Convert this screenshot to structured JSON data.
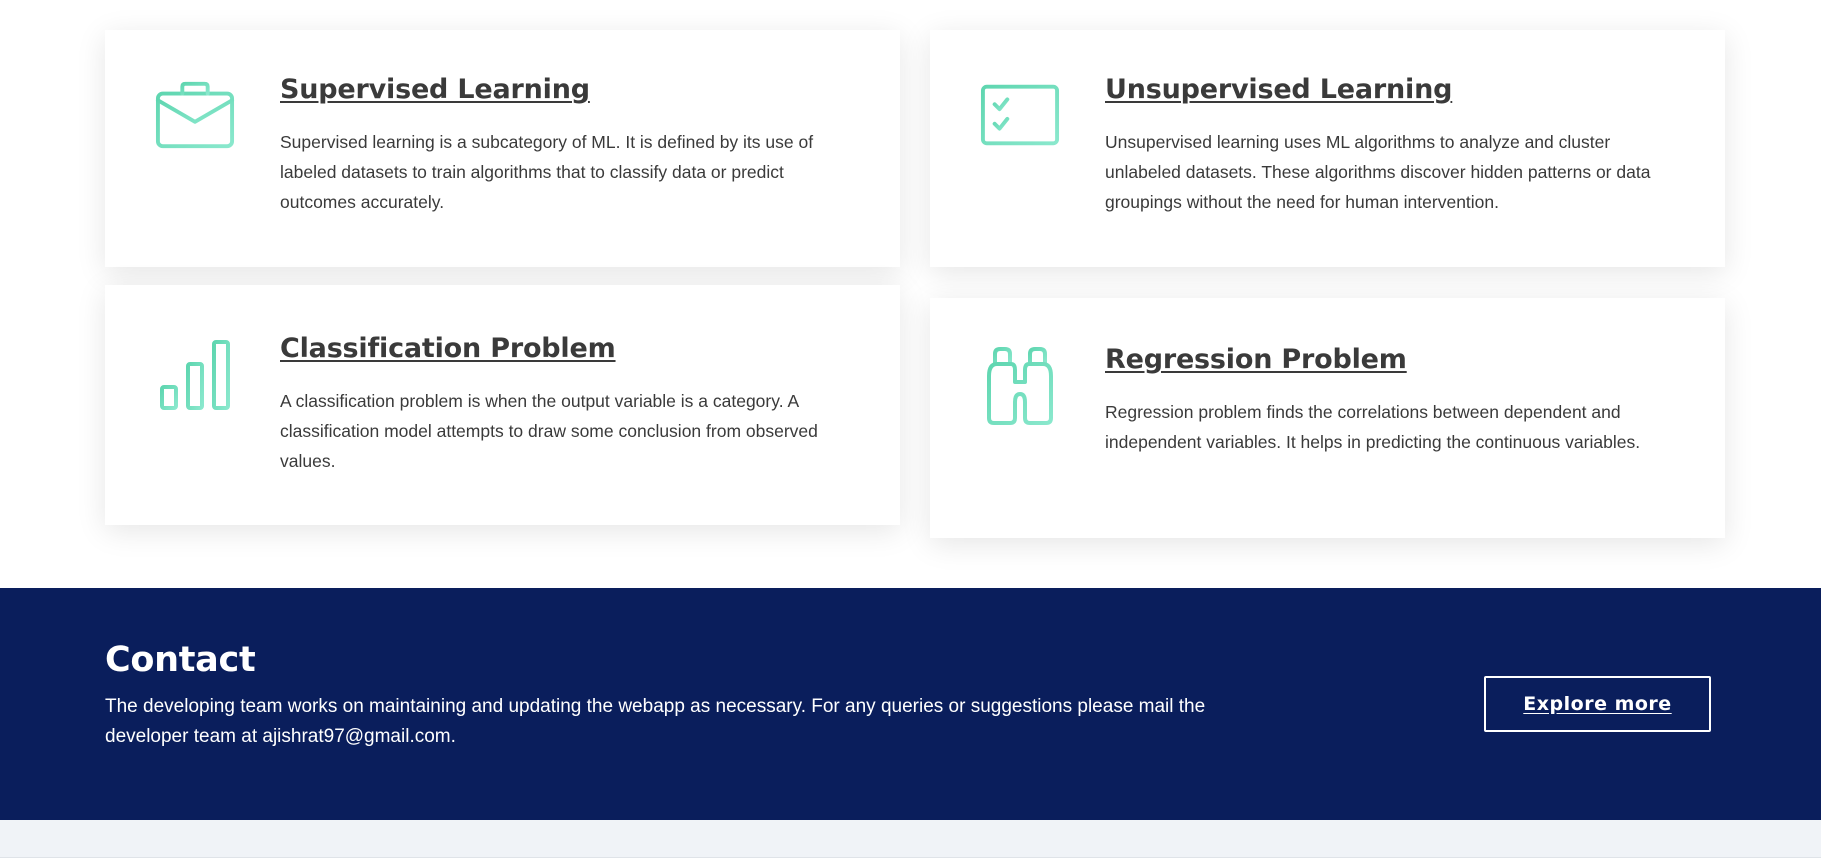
{
  "colors": {
    "accent_gradient_start": "#5fd6b0",
    "accent_gradient_end": "#8ae8cd",
    "contact_background": "#0a1e5c",
    "card_text": "#3a3a3a",
    "footer_background": "#f0f3f7"
  },
  "cards": [
    {
      "icon": "briefcase-icon",
      "title": "Supervised Learning",
      "description": "Supervised learning is a subcategory of ML. It is defined by its use of labeled datasets to train algorithms that to classify data or predict outcomes accurately."
    },
    {
      "icon": "checklist-icon",
      "title": "Unsupervised Learning",
      "description": "Unsupervised learning uses ML algorithms to analyze and cluster unlabeled datasets. These algorithms discover hidden patterns or data groupings without the need for human intervention."
    },
    {
      "icon": "bar-chart-icon",
      "title": "Classification Problem",
      "description": "A classification problem is when the output variable is a category. A classification model attempts to draw some conclusion from observed values."
    },
    {
      "icon": "binoculars-icon",
      "title": "Regression Problem",
      "description": "Regression problem finds the correlations between dependent and independent variables. It helps in predicting the continuous variables."
    }
  ],
  "contact": {
    "heading": "Contact",
    "text": "The developing team works on maintaining and updating the webapp as necessary. For any queries or suggestions please mail the developer team at ajishrat97@gmail.com.",
    "button_label": "Explore more"
  }
}
